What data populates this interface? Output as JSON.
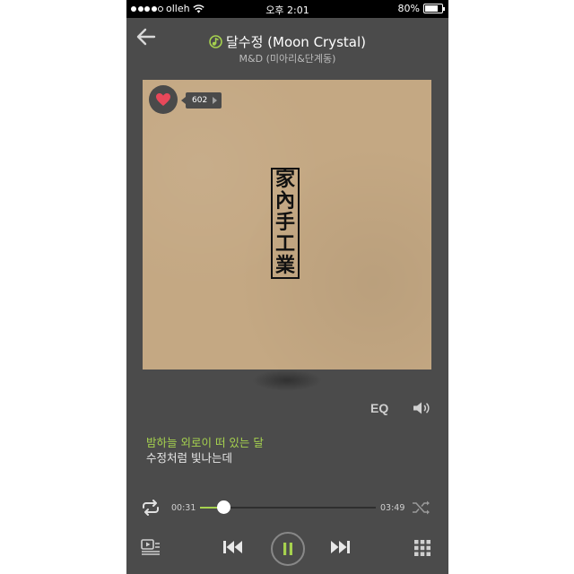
{
  "status_bar": {
    "carrier": "olleh",
    "time": "오후 2:01",
    "battery_percent": "80%",
    "battery_level": 0.8,
    "signal_dots_filled": 4
  },
  "header": {
    "title": "달수정 (Moon Crystal)",
    "artist": "M&D (미아리&단계동)"
  },
  "album": {
    "cover_text": [
      "家",
      "內",
      "手",
      "工",
      "業"
    ],
    "like_count": "602"
  },
  "controls": {
    "eq_label": "EQ"
  },
  "lyrics": {
    "current": "밤하늘 외로이 떠 있는 달",
    "next": "수정처럼 빛나는데"
  },
  "progress": {
    "current_time": "00:31",
    "total_time": "03:49",
    "fraction": 0.135
  },
  "icons": {
    "back": "arrow-left-icon",
    "like": "heart-icon",
    "volume": "speaker-icon",
    "repeat": "repeat-icon",
    "shuffle": "shuffle-icon",
    "playlist": "playlist-icon",
    "previous": "previous-icon",
    "pause": "pause-icon",
    "next": "next-icon",
    "menu": "grid-icon"
  },
  "colors": {
    "accent": "#a6d24f",
    "background": "#4b4b4b",
    "heart": "#e8485a"
  }
}
